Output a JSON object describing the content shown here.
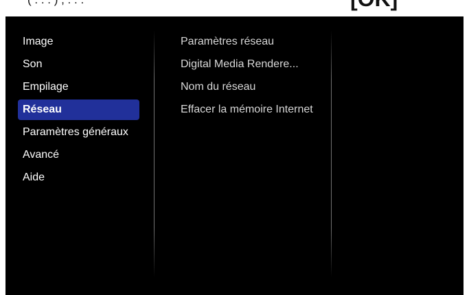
{
  "top_banner": {
    "text": "(  .  .  .  ) ,  .  .  .  ",
    "ok_label": "[OK]"
  },
  "main_menu": {
    "items": [
      {
        "label": "Image"
      },
      {
        "label": "Son"
      },
      {
        "label": "Empilage"
      },
      {
        "label": "Réseau",
        "selected": true
      },
      {
        "label": "Paramètres généraux"
      },
      {
        "label": "Avancé"
      },
      {
        "label": "Aide"
      }
    ]
  },
  "sub_menu": {
    "items": [
      {
        "label": "Paramètres réseau"
      },
      {
        "label": "Digital Media Rendere..."
      },
      {
        "label": "Nom du réseau"
      },
      {
        "label": "Effacer la mémoire Internet"
      }
    ]
  },
  "colors": {
    "background": "#000000",
    "selected": "#21309a",
    "text": "#ffffff"
  }
}
